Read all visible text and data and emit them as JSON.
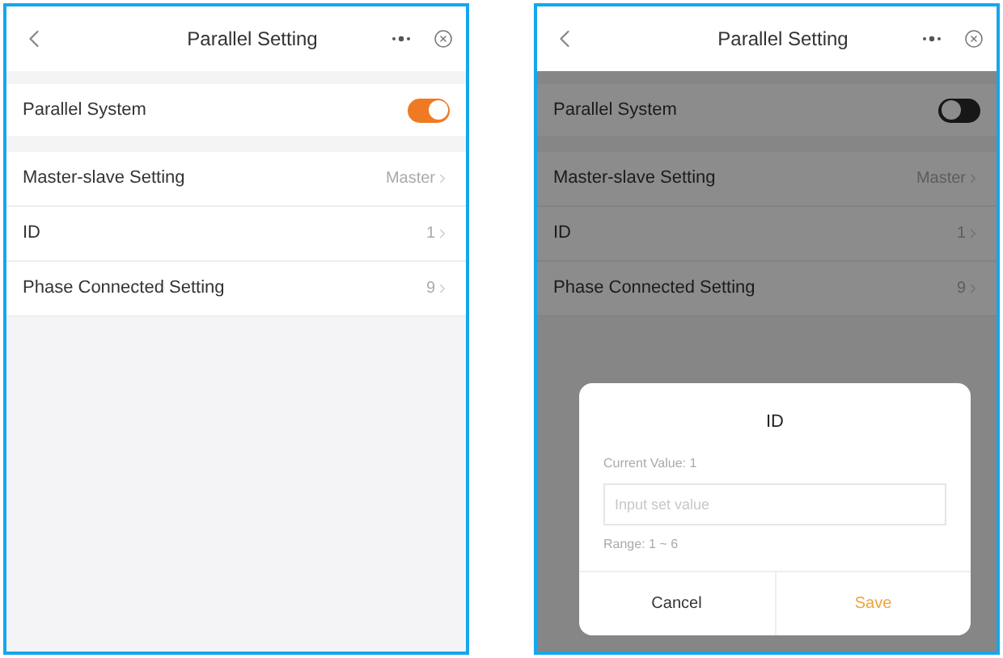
{
  "screens": [
    {
      "title": "Parallel Setting",
      "rows": [
        {
          "kind": "toggle",
          "label": "Parallel System",
          "on": true
        },
        {
          "kind": "link",
          "label": "Master-slave Setting",
          "value": "Master"
        },
        {
          "kind": "link",
          "label": "ID",
          "value": "1"
        },
        {
          "kind": "link",
          "label": "Phase Connected Setting",
          "value": "9"
        }
      ]
    },
    {
      "title": "Parallel Setting",
      "rows": [
        {
          "kind": "toggle",
          "label": "Parallel System",
          "on": false
        },
        {
          "kind": "link",
          "label": "Master-slave Setting",
          "value": "Master"
        },
        {
          "kind": "link",
          "label": "ID",
          "value": "1"
        },
        {
          "kind": "link",
          "label": "Phase Connected Setting",
          "value": "9"
        }
      ],
      "dialog": {
        "title": "ID",
        "current": "Current Value: 1",
        "placeholder": "Input set value",
        "range": "Range: 1 ~ 6",
        "buttons": [
          {
            "kind": "cancel",
            "label": "Cancel"
          },
          {
            "kind": "primary",
            "label": "Save"
          }
        ]
      }
    }
  ]
}
